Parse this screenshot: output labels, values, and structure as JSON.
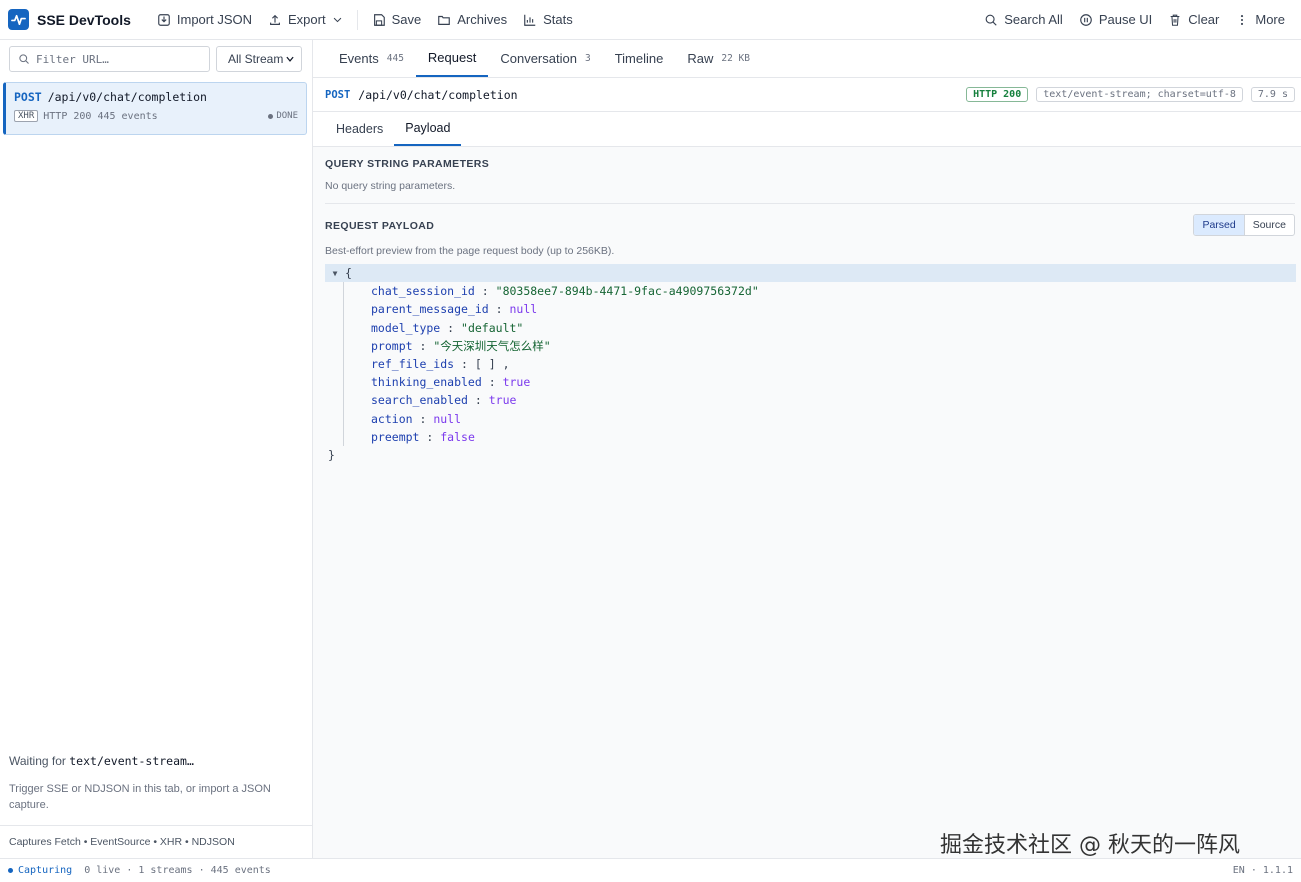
{
  "app": {
    "title": "SSE DevTools"
  },
  "toolbar": {
    "import_label": "Import JSON",
    "export_label": "Export",
    "save_label": "Save",
    "archives_label": "Archives",
    "stats_label": "Stats",
    "search_all_label": "Search All",
    "pause_label": "Pause UI",
    "clear_label": "Clear",
    "more_label": "More"
  },
  "sidebar": {
    "filter_placeholder": "Filter URL…",
    "stream_filter_value": "All Stream",
    "streams": [
      {
        "method": "POST",
        "url": "/api/v0/chat/completion",
        "type": "XHR",
        "summary": "HTTP 200 445 events",
        "state": "DONE"
      }
    ],
    "waiting_prefix": "Waiting for ",
    "waiting_code": "text/event-stream…",
    "trigger_text": "Trigger SSE or NDJSON in this tab, or import a JSON capture.",
    "captures_text": "Captures Fetch • EventSource • XHR • NDJSON"
  },
  "tabs": [
    {
      "label": "Events",
      "count": "445"
    },
    {
      "label": "Request",
      "count": ""
    },
    {
      "label": "Conversation",
      "count": "3"
    },
    {
      "label": "Timeline",
      "count": ""
    },
    {
      "label": "Raw",
      "count": "22 KB"
    }
  ],
  "request": {
    "method": "POST",
    "url": "/api/v0/chat/completion",
    "status": "HTTP 200",
    "content_type": "text/event-stream; charset=utf-8",
    "duration": "7.9 s"
  },
  "subtabs": [
    "Headers",
    "Payload"
  ],
  "query_section": {
    "title": "QUERY STRING PARAMETERS",
    "empty_text": "No query string parameters."
  },
  "payload_section": {
    "title": "REQUEST PAYLOAD",
    "toggle_parsed": "Parsed",
    "toggle_source": "Source",
    "description": "Best-effort preview from the page request body (up to 256KB).",
    "open_brace": "{",
    "close_brace": "}",
    "fields": [
      {
        "key": "chat_session_id",
        "value": "\"80358ee7-894b-4471-9fac-a4909756372d\"",
        "kind": "str"
      },
      {
        "key": "parent_message_id",
        "value": "null",
        "kind": "null"
      },
      {
        "key": "model_type",
        "value": "\"default\"",
        "kind": "str"
      },
      {
        "key": "prompt",
        "value": "\"今天深圳天气怎么样\"",
        "kind": "str"
      },
      {
        "key": "ref_file_ids",
        "value": "[ ] ,",
        "kind": "punc"
      },
      {
        "key": "thinking_enabled",
        "value": "true",
        "kind": "bool"
      },
      {
        "key": "search_enabled",
        "value": "true",
        "kind": "bool"
      },
      {
        "key": "action",
        "value": "null",
        "kind": "null"
      },
      {
        "key": "preempt",
        "value": "false",
        "kind": "bool"
      }
    ]
  },
  "status_bar": {
    "capturing": "Capturing",
    "stats": "0 live · 1 streams · 445 events",
    "version": "EN · 1.1.1"
  },
  "watermark": "掘金技术社区 @ 秋天的一阵风",
  "colors": {
    "accent": "#1565c0",
    "success": "#15803d"
  }
}
